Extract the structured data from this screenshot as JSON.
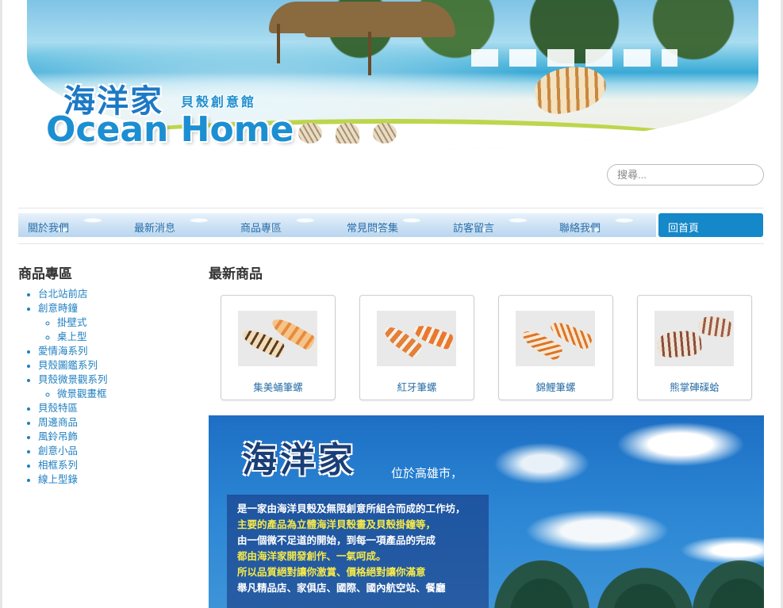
{
  "banner": {
    "logo_cn": "海洋家",
    "logo_subtitle": "貝殼創意館",
    "logo_en": "Ocean Home"
  },
  "search": {
    "placeholder": "搜尋..."
  },
  "nav": {
    "items": [
      {
        "label": "關於我們"
      },
      {
        "label": "最新消息"
      },
      {
        "label": "商品專區"
      },
      {
        "label": "常見問答集"
      },
      {
        "label": "訪客留言"
      },
      {
        "label": "聯絡我們"
      },
      {
        "label": "回首頁",
        "active": true
      }
    ]
  },
  "sidebar": {
    "title": "商品專區",
    "items": [
      {
        "label": "台北站前店"
      },
      {
        "label": "創意時鐘"
      },
      {
        "label": "掛壁式"
      },
      {
        "label": "桌上型"
      },
      {
        "label": "愛情海系列"
      },
      {
        "label": "貝殼圖鑑系列"
      },
      {
        "label": "貝殼微景觀系列"
      },
      {
        "label": "微景觀畫框"
      },
      {
        "label": "貝殼特區"
      },
      {
        "label": "周邊商品"
      },
      {
        "label": "風鈴吊飾"
      },
      {
        "label": "創意小品"
      },
      {
        "label": "相框系列"
      },
      {
        "label": "線上型錄"
      }
    ]
  },
  "main": {
    "title": "最新商品",
    "products": [
      {
        "name": "集美蛹筆螺"
      },
      {
        "name": "紅牙筆螺"
      },
      {
        "name": "錦鯉筆螺"
      },
      {
        "name": "熊掌硨磲蛤"
      }
    ]
  },
  "promo": {
    "title": "海洋家",
    "tagline": "位於高雄市，",
    "lines": [
      {
        "text": "是一家由海洋貝殼及無限創意所組合而成的工作坊，",
        "color": "#ffffff"
      },
      {
        "text": "主要的產品為立體海洋貝殼畫及貝殼掛鐘等，",
        "color": "#f6e94a"
      },
      {
        "text": "由一個微不足道的開始，到每一項產品的完成",
        "color": "#ffffff"
      },
      {
        "text": "都由海洋家開發創作、一氣呵成。",
        "color": "#f6e94a"
      },
      {
        "text": "所以品質絕對讓你激賞、價格絕對讓你滿意",
        "color": "#f6e94a"
      },
      {
        "text": "舉凡精品店、家俱店、國際、國內航空站、餐廳",
        "color": "#ffffff"
      }
    ]
  },
  "colors": {
    "accent": "#1488c8",
    "link": "#1f7fc0"
  }
}
